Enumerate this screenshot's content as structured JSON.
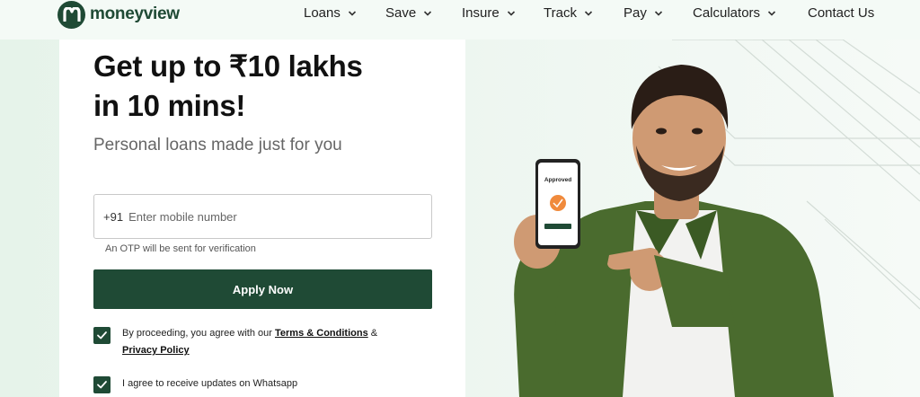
{
  "brand": {
    "name": "moneyview"
  },
  "nav": [
    {
      "label": "Loans"
    },
    {
      "label": "Save"
    },
    {
      "label": "Insure"
    },
    {
      "label": "Track"
    },
    {
      "label": "Pay"
    },
    {
      "label": "Calculators"
    },
    {
      "label": "Contact Us"
    }
  ],
  "hero": {
    "headline_line1": "Get up to ₹10 lakhs",
    "headline_line2": "in 10 mins!",
    "subheading": "Personal loans made just for you",
    "phone_screen_label": "Approved"
  },
  "form": {
    "country_code": "+91",
    "mobile_placeholder": "Enter mobile number",
    "mobile_value": "",
    "otp_note": "An OTP will be sent for verification",
    "apply_label": "Apply Now",
    "consent_prefix": "By proceeding, you agree with our",
    "terms_link": "Terms & Conditions",
    "amp": "&",
    "privacy_link": "Privacy Policy",
    "whatsapp_label": "I agree to receive updates on Whatsapp",
    "consent_checked": true,
    "whatsapp_checked": true
  },
  "colors": {
    "brand_green": "#1f4a35",
    "background": "#e6f3ea",
    "shirt_green": "#4a6b2e"
  },
  "icons": [
    "logo-m-icon",
    "chevron-down-icon",
    "checkmark-icon"
  ]
}
